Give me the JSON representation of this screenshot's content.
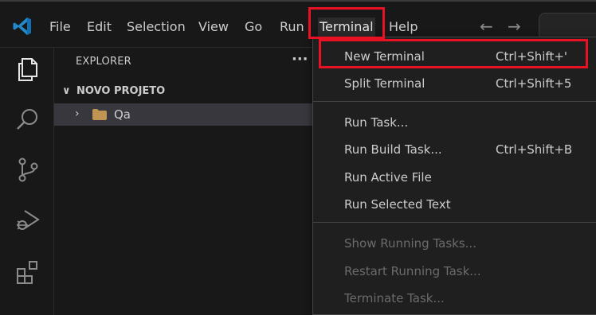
{
  "titlebar": {
    "menu": [
      {
        "label": "File"
      },
      {
        "label": "Edit"
      },
      {
        "label": "Selection"
      },
      {
        "label": "View"
      },
      {
        "label": "Go"
      },
      {
        "label": "Run"
      },
      {
        "label": "Terminal"
      },
      {
        "label": "Help"
      }
    ],
    "back_arrow": "←",
    "forward_arrow": "→"
  },
  "sidebar": {
    "title": "EXPLORER",
    "more": "···",
    "folder_name": "NOVO PROJETO",
    "folder_chevron": "∨",
    "tree": [
      {
        "chevron": "›",
        "label": "Qa"
      }
    ]
  },
  "terminal_menu": {
    "groups": [
      [
        {
          "label": "New Terminal",
          "shortcut": "Ctrl+Shift+'"
        },
        {
          "label": "Split Terminal",
          "shortcut": "Ctrl+Shift+5"
        }
      ],
      [
        {
          "label": "Run Task...",
          "shortcut": ""
        },
        {
          "label": "Run Build Task...",
          "shortcut": "Ctrl+Shift+B"
        },
        {
          "label": "Run Active File",
          "shortcut": ""
        },
        {
          "label": "Run Selected Text",
          "shortcut": ""
        }
      ],
      [
        {
          "label": "Show Running Tasks...",
          "shortcut": "",
          "disabled": true
        },
        {
          "label": "Restart Running Task...",
          "shortcut": "",
          "disabled": true
        },
        {
          "label": "Terminate Task...",
          "shortcut": "",
          "disabled": true
        }
      ]
    ]
  },
  "colors": {
    "highlight_box": "#e81224",
    "vscode_blue": "#2489ca",
    "folder_yellow": "#c09553"
  }
}
